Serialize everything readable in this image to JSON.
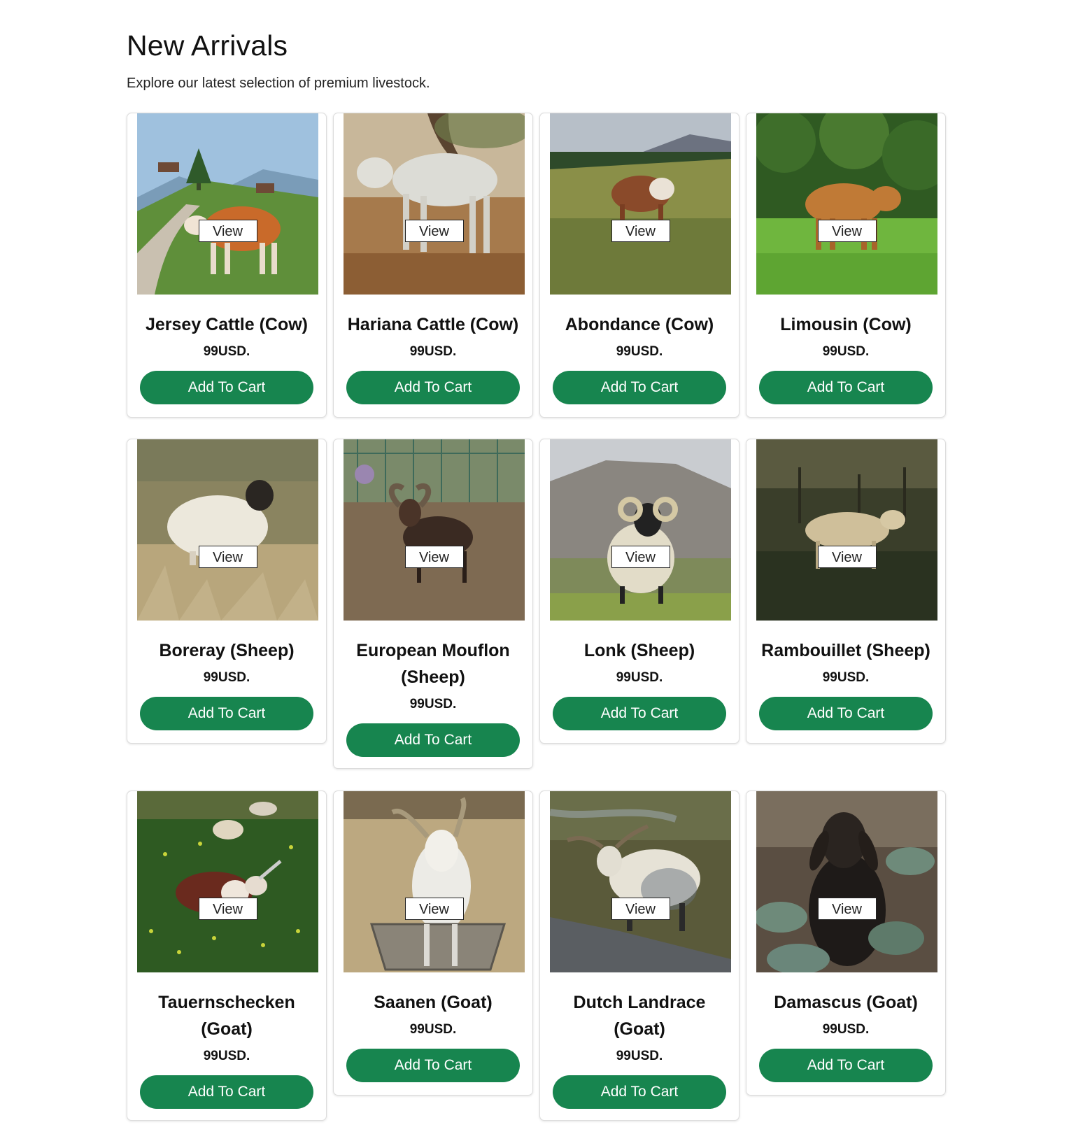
{
  "header": {
    "title": "New Arrivals",
    "subtitle": "Explore our latest selection of premium livestock."
  },
  "products": [
    {
      "name": "Jersey Cattle (Cow)",
      "price": "99USD.",
      "view_label": "View",
      "cart_label": "Add To Cart",
      "image_icon": "jersey-cow-photo"
    },
    {
      "name": "Hariana Cattle (Cow)",
      "price": "99USD.",
      "view_label": "View",
      "cart_label": "Add To Cart",
      "image_icon": "hariana-cow-photo"
    },
    {
      "name": "Abondance (Cow)",
      "price": "99USD.",
      "view_label": "View",
      "cart_label": "Add To Cart",
      "image_icon": "abondance-cow-photo"
    },
    {
      "name": "Limousin (Cow)",
      "price": "99USD.",
      "view_label": "View",
      "cart_label": "Add To Cart",
      "image_icon": "limousin-cow-photo"
    },
    {
      "name": "Boreray (Sheep)",
      "price": "99USD.",
      "view_label": "View",
      "cart_label": "Add To Cart",
      "image_icon": "boreray-sheep-photo"
    },
    {
      "name": "European Mouflon (Sheep)",
      "price": "99USD.",
      "view_label": "View",
      "cart_label": "Add To Cart",
      "image_icon": "mouflon-sheep-photo"
    },
    {
      "name": "Lonk (Sheep)",
      "price": "99USD.",
      "view_label": "View",
      "cart_label": "Add To Cart",
      "image_icon": "lonk-sheep-photo"
    },
    {
      "name": "Rambouillet (Sheep)",
      "price": "99USD.",
      "view_label": "View",
      "cart_label": "Add To Cart",
      "image_icon": "rambouillet-sheep-photo"
    },
    {
      "name": "Tauernschecken (Goat)",
      "price": "99USD.",
      "view_label": "View",
      "cart_label": "Add To Cart",
      "image_icon": "tauernschecken-goat-photo"
    },
    {
      "name": "Saanen (Goat)",
      "price": "99USD.",
      "view_label": "View",
      "cart_label": "Add To Cart",
      "image_icon": "saanen-goat-photo"
    },
    {
      "name": "Dutch Landrace (Goat)",
      "price": "99USD.",
      "view_label": "View",
      "cart_label": "Add To Cart",
      "image_icon": "dutch-landrace-goat-photo"
    },
    {
      "name": "Damascus (Goat)",
      "price": "99USD.",
      "view_label": "View",
      "cart_label": "Add To Cart",
      "image_icon": "damascus-goat-photo"
    }
  ],
  "colors": {
    "button_green": "#17854f",
    "card_border": "#dcdcdc"
  }
}
